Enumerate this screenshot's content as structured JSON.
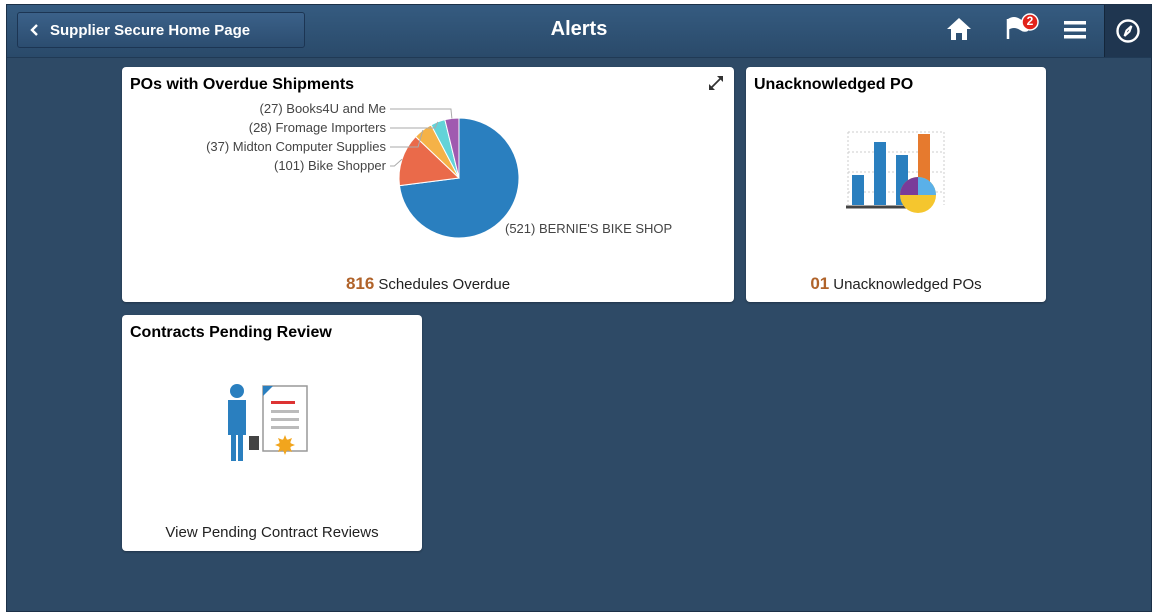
{
  "header": {
    "back_label": "Supplier Secure Home Page",
    "title": "Alerts",
    "notification_count": "2"
  },
  "tiles": [
    {
      "title": "POs with Overdue Shipments",
      "footer_count": "816",
      "footer_text": "Schedules Overdue"
    },
    {
      "title": "Unacknowledged PO",
      "footer_count": "01",
      "footer_text": "Unacknowledged POs"
    },
    {
      "title": "Contracts Pending Review",
      "footer_text": "View Pending Contract Reviews"
    }
  ],
  "chart_data": {
    "type": "pie",
    "title": "POs with Overdue Shipments",
    "slices": [
      {
        "label": "(521) BERNIE'S BIKE SHOP",
        "value": 521,
        "color": "#2a7fbf"
      },
      {
        "label": "(101) Bike Shopper",
        "value": 101,
        "color": "#ea6a4a"
      },
      {
        "label": "(37) Midton Computer Supplies",
        "value": 37,
        "color": "#f5b247"
      },
      {
        "label": "(28) Fromage Importers",
        "value": 28,
        "color": "#63d3d8"
      },
      {
        "label": "(27) Books4U and Me",
        "value": 27,
        "color": "#a05ab0"
      }
    ]
  },
  "colors": {
    "background": "#2e4a66",
    "accent_count": "#b0632a",
    "badge": "#e2231a"
  }
}
